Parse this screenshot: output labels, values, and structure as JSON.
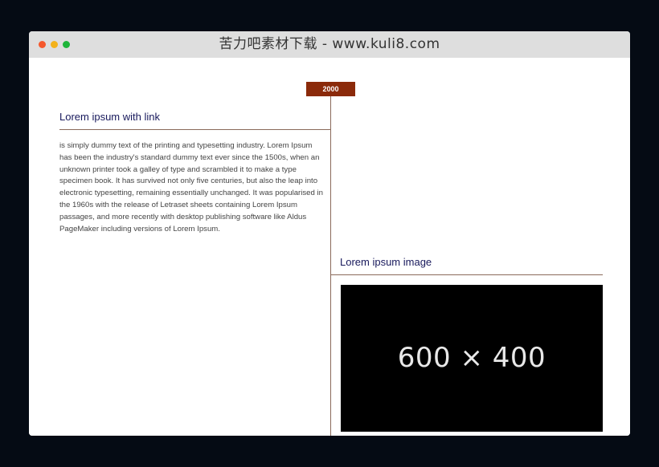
{
  "window": {
    "title": "苦力吧素材下载 - www.kuli8.com",
    "controls": {
      "close_color": "#f5582d",
      "minimize_color": "#f3b21b",
      "maximize_color": "#1eb53a"
    }
  },
  "timeline": {
    "year_badge": "2000",
    "badge_color": "#8b2a0a",
    "entries": [
      {
        "side": "left",
        "title": "Lorem ipsum with link",
        "body": "is simply dummy text of the printing and typesetting industry. Lorem Ipsum has been the industry's standard dummy text ever since the 1500s, when an unknown printer took a galley of type and scrambled it to make a type specimen book. It has survived not only five centuries, but also the leap into electronic typesetting, remaining essentially unchanged. It was popularised in the 1960s with the release of Letraset sheets containing Lorem Ipsum passages, and more recently with desktop publishing software like Aldus PageMaker including versions of Lorem Ipsum."
      },
      {
        "side": "right",
        "title": "Lorem ipsum image",
        "image_label": "600 × 400"
      }
    ]
  }
}
